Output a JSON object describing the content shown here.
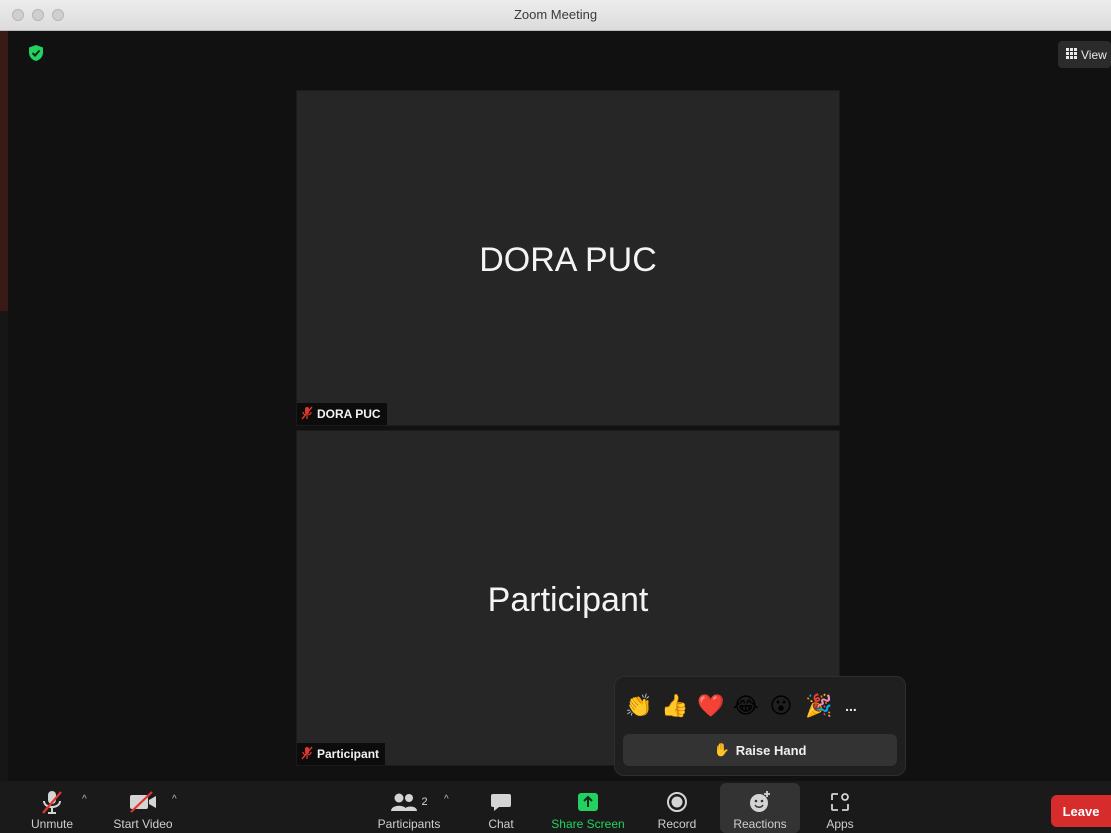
{
  "window": {
    "title": "Zoom Meeting"
  },
  "topbar": {
    "view_label": "View"
  },
  "tiles": [
    {
      "display_name": "DORA PUC",
      "label": "DORA PUC"
    },
    {
      "display_name": "Participant",
      "label": "Participant"
    }
  ],
  "reactions": {
    "emojis": [
      "👏",
      "👍",
      "❤️",
      "😂",
      "😮",
      "🎉"
    ],
    "more_label": "...",
    "raise_hand_icon": "✋",
    "raise_hand_label": "Raise Hand"
  },
  "toolbar": {
    "unmute_label": "Unmute",
    "start_video_label": "Start Video",
    "participants_label": "Participants",
    "participants_count": "2",
    "chat_label": "Chat",
    "share_screen_label": "Share Screen",
    "record_label": "Record",
    "reactions_label": "Reactions",
    "apps_label": "Apps",
    "leave_label": "Leave"
  },
  "colors": {
    "accent_green": "#23d160",
    "leave_red": "#d72c2c",
    "muted_red": "#e0362c"
  }
}
